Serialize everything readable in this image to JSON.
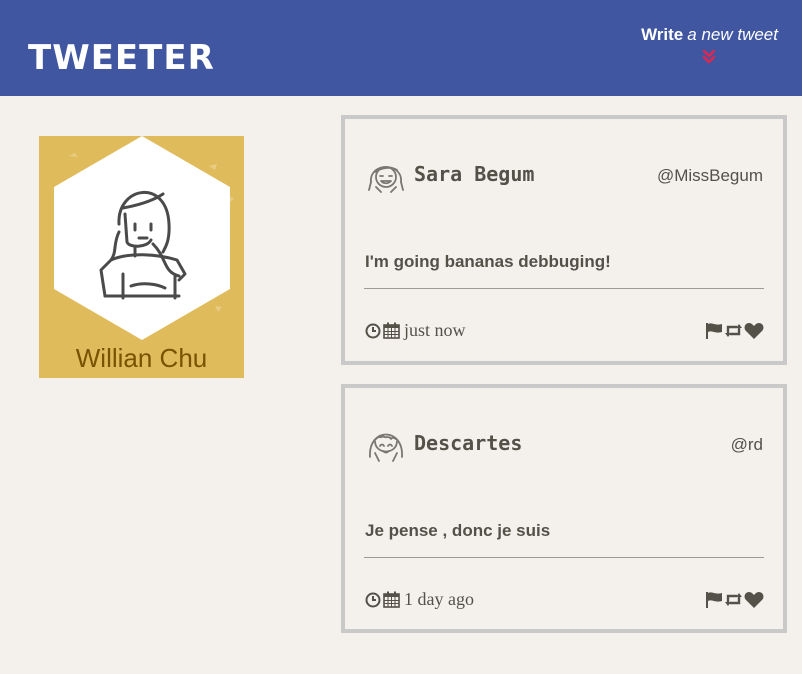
{
  "nav": {
    "brand": "TWEETER",
    "compose_strong": "Write",
    "compose_em": "a new tweet"
  },
  "profile": {
    "name": "Willian Chu"
  },
  "tweets": [
    {
      "name": "Sara Begum",
      "handle": "@MissBegum",
      "text": "I'm going bananas debbuging!",
      "time": "just now"
    },
    {
      "name": "Descartes",
      "handle": "@rd",
      "text": "Je pense , donc je suis",
      "time": "1 day ago"
    }
  ],
  "icons": {
    "compose": "double-chevron-down-icon",
    "clock": "clock-icon",
    "calendar": "calendar-icon",
    "flag": "flag-icon",
    "retweet": "retweet-icon",
    "like": "heart-icon"
  },
  "colors": {
    "navbar": "#4056a1",
    "chevron": "#e2264d",
    "profile_bg": "#e0bb5b",
    "page_bg": "#f4f1ec",
    "card_border": "#c9c9c9",
    "text": "#545149"
  }
}
